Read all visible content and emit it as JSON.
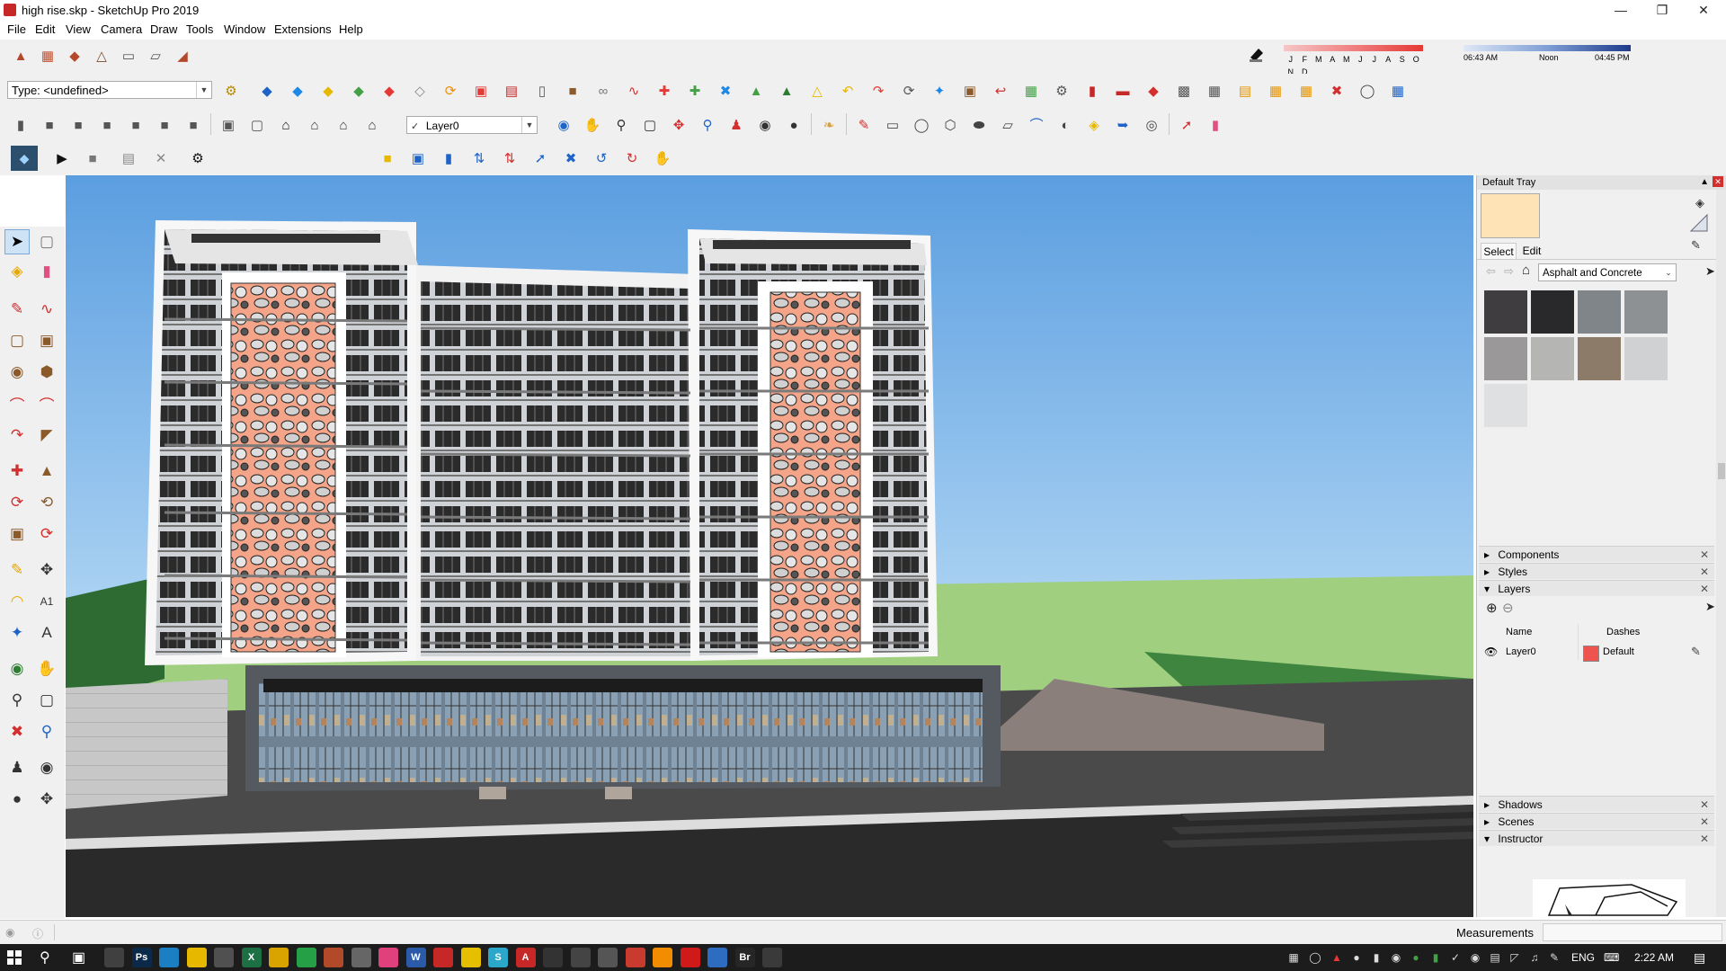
{
  "window": {
    "title": "high rise.skp - SketchUp Pro 2019",
    "minimize_icon": "minimize-icon",
    "maximize_icon": "restore-icon",
    "close_icon": "close-icon"
  },
  "menu": [
    "File",
    "Edit",
    "View",
    "Camera",
    "Draw",
    "Tools",
    "Window",
    "Extensions",
    "Help"
  ],
  "toolbar": {
    "type_combo_value": "Type: <undefined>",
    "layer_combo_value": "Layer0",
    "colors": {
      "accent_red": "#d32f2f",
      "accent_blue": "#1e63c7",
      "accent_green": "#43a047",
      "accent_yellow": "#f5b800",
      "accent_orange": "#f08c00"
    }
  },
  "shadow": {
    "months": [
      "J",
      "F",
      "M",
      "A",
      "M",
      "J",
      "J",
      "A",
      "S",
      "O",
      "N",
      "D"
    ],
    "time_start": "06:43 AM",
    "time_mid": "Noon",
    "time_end": "04:45 PM"
  },
  "tray": {
    "title": "Default Tray",
    "material_swatch_color": "#fde3b6",
    "tabs": [
      "Select",
      "Edit"
    ],
    "active_tab": "Select",
    "collection": "Asphalt and Concrete",
    "swatches": [
      "#3f3d40",
      "#29292b",
      "#80858a",
      "#8e9194",
      "#9a9899",
      "#b5b6b3",
      "#8c7b68",
      "#cfd1d3",
      "#dfe0e1"
    ],
    "panels_top": [
      {
        "label": "Components",
        "expanded": false
      },
      {
        "label": "Styles",
        "expanded": false
      },
      {
        "label": "Layers",
        "expanded": true
      }
    ],
    "layers": {
      "col_name": "Name",
      "col_dashes": "Dashes",
      "rows": [
        {
          "name": "Layer0",
          "color": "#ef5350",
          "dashes": "Default"
        }
      ]
    },
    "panels_bottom": [
      {
        "label": "Shadows",
        "expanded": false
      },
      {
        "label": "Scenes",
        "expanded": false
      },
      {
        "label": "Instructor",
        "expanded": true
      }
    ]
  },
  "status": {
    "measurements_label": "Measurements"
  },
  "taskbar": {
    "lang": "ENG",
    "time": "2:22 AM",
    "apps": [
      {
        "icon": "calculator-icon",
        "color": "#404040",
        "text": ""
      },
      {
        "icon": "photoshop-icon",
        "color": "#0b2a4a",
        "text": "Ps"
      },
      {
        "icon": "edge-icon",
        "color": "#1b7fc4",
        "text": ""
      },
      {
        "icon": "file-explorer-icon",
        "color": "#e6b800",
        "text": ""
      },
      {
        "icon": "store-icon",
        "color": "#505050",
        "text": ""
      },
      {
        "icon": "excel-icon",
        "color": "#1d7044",
        "text": "X"
      },
      {
        "icon": "chrome-icon",
        "color": "#d9a400",
        "text": ""
      },
      {
        "icon": "whatsapp-icon",
        "color": "#25a046",
        "text": ""
      },
      {
        "icon": "app-icon",
        "color": "#b24a2a",
        "text": ""
      },
      {
        "icon": "app-icon",
        "color": "#666",
        "text": ""
      },
      {
        "icon": "app-icon",
        "color": "#e0407b",
        "text": ""
      },
      {
        "icon": "word-icon",
        "color": "#2a5aa8",
        "text": "W"
      },
      {
        "icon": "sketchup-icon",
        "color": "#c62828",
        "text": ""
      },
      {
        "icon": "sticky-notes-icon",
        "color": "#e6c000",
        "text": ""
      },
      {
        "icon": "app-icon",
        "color": "#2aa7c9",
        "text": "S"
      },
      {
        "icon": "acrobat-icon",
        "color": "#c62828",
        "text": "A"
      },
      {
        "icon": "app-icon",
        "color": "#333",
        "text": ""
      },
      {
        "icon": "app-icon",
        "color": "#444",
        "text": ""
      },
      {
        "icon": "pdf-icon",
        "color": "#555",
        "text": ""
      },
      {
        "icon": "sketchup-icon",
        "color": "#c83b2e",
        "text": ""
      },
      {
        "icon": "vlc-icon",
        "color": "#f28c00",
        "text": ""
      },
      {
        "icon": "opera-icon",
        "color": "#d01919",
        "text": ""
      },
      {
        "icon": "app-icon",
        "color": "#2d6cc0",
        "text": ""
      },
      {
        "icon": "bridge-icon",
        "color": "#262626",
        "text": "Br"
      },
      {
        "icon": "app-icon",
        "color": "#3a3a3a",
        "text": ""
      }
    ]
  }
}
